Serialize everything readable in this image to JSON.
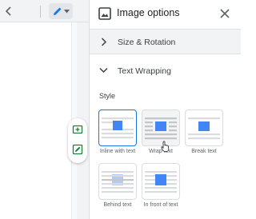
{
  "panel": {
    "title": "Image options",
    "close_icon": "close-icon",
    "header_icon": "image-icon"
  },
  "sections": {
    "size_rotation": {
      "label": "Size & Rotation",
      "expanded": false
    },
    "text_wrapping": {
      "label": "Text Wrapping",
      "expanded": true
    }
  },
  "wrap": {
    "style_label": "Style",
    "options": [
      {
        "label": "Inline with text",
        "selected": true
      },
      {
        "label": "Wrap text",
        "selected": false
      },
      {
        "label": "Break text",
        "selected": false
      },
      {
        "label": "Behind text",
        "selected": false
      },
      {
        "label": "In front of text",
        "selected": false
      }
    ]
  },
  "colors": {
    "accent": "#1a73e8",
    "image_block": "#4285f4",
    "text_lines": "#dadce0"
  }
}
